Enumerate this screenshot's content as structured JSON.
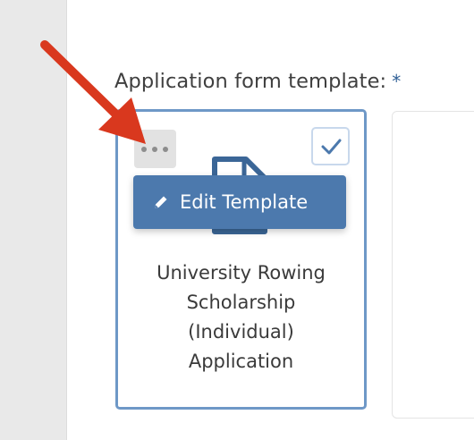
{
  "form": {
    "field_label": "Application form template:",
    "required_marker": "*"
  },
  "template_card": {
    "title_lines": [
      "University Rowing",
      "Scholarship",
      "(Individual)",
      "Application"
    ],
    "edit_button_label": "Edit Template",
    "selected": true,
    "menu_icon": "more-dots-icon",
    "checkbox_icon": "checkmark-icon",
    "doc_icon": "document-icon",
    "edit_icon": "pencil-icon"
  },
  "annotation": {
    "icon": "red-arrow-icon",
    "color": "#d9381e"
  },
  "colors": {
    "accent": "#4c79ad",
    "card_border": "#6e98c7",
    "sidebar": "#e9e9e9"
  }
}
